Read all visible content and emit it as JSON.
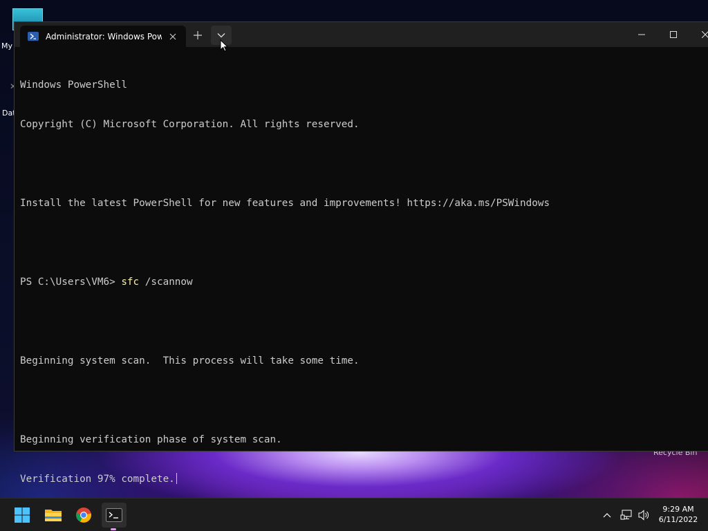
{
  "desktop": {
    "icon_label_1": "My",
    "icon_label_2": "Dat",
    "recycle_bin_label": "Recycle Bin"
  },
  "window": {
    "tab_title": "Administrator: Windows PowerShell",
    "tab_icon": "powershell-icon",
    "new_tab_icon": "plus-icon",
    "dropdown_icon": "chevron-down-icon",
    "minimize_icon": "minimize-icon",
    "maximize_icon": "maximize-icon",
    "close_icon": "close-icon"
  },
  "console": {
    "line1": "Windows PowerShell",
    "line2": "Copyright (C) Microsoft Corporation. All rights reserved.",
    "line3": "Install the latest PowerShell for new features and improvements! https://aka.ms/PSWindows",
    "prompt": "PS C:\\Users\\VM6> ",
    "command": "sfc",
    "command_args": " /scannow",
    "line5": "Beginning system scan.  This process will take some time.",
    "line6": "Beginning verification phase of system scan.",
    "line7": "Verification 97% complete."
  },
  "taskbar": {
    "apps": [
      "windows-start-icon",
      "file-explorer-icon",
      "chrome-icon",
      "terminal-icon"
    ],
    "time": "9:29 AM",
    "date": "6/11/2022"
  },
  "colors": {
    "console_bg": "#0c0c0c",
    "console_text": "#cccccc",
    "command_text": "#f9f1a5",
    "titlebar": "#202020",
    "taskbar": "#1c1c1c"
  }
}
